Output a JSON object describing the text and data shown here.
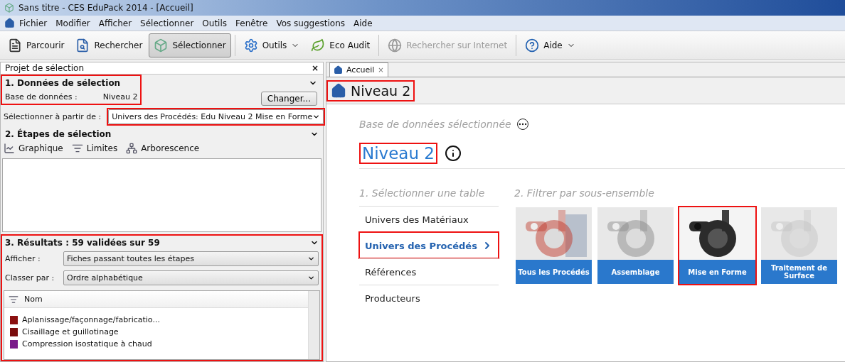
{
  "window": {
    "title": "Sans titre - CES EduPack 2014 - [Accueil]"
  },
  "menu": [
    "Fichier",
    "Modifier",
    "Afficher",
    "Sélectionner",
    "Outils",
    "Fenêtre",
    "Vos suggestions",
    "Aide"
  ],
  "toolbar": [
    {
      "label": "Parcourir",
      "kind": "browse",
      "selected": false,
      "disabled": false,
      "dropdown": false
    },
    {
      "label": "Rechercher",
      "kind": "search",
      "selected": false,
      "disabled": false,
      "dropdown": false
    },
    {
      "label": "Sélectionner",
      "kind": "select",
      "selected": true,
      "disabled": false,
      "dropdown": false
    },
    {
      "label": "Outils",
      "kind": "tools",
      "selected": false,
      "disabled": false,
      "dropdown": true
    },
    {
      "label": "Eco Audit",
      "kind": "eco",
      "selected": false,
      "disabled": false,
      "dropdown": false
    },
    {
      "label": "Rechercher sur Internet",
      "kind": "web",
      "selected": false,
      "disabled": true,
      "dropdown": false
    },
    {
      "label": "Aide",
      "kind": "help",
      "selected": false,
      "disabled": false,
      "dropdown": true
    }
  ],
  "left_panel": {
    "title": "Projet de sélection",
    "close": "×",
    "data_section": {
      "title": "1. Données de sélection",
      "highlighted": true,
      "database_label": "Base de données :",
      "database_value": "Niveau 2",
      "change_button": "Changer..."
    },
    "select_from": {
      "label": "Sélectionner à partir de :",
      "value": "Univers des Procédés: Edu Niveau 2 Mise en Forme",
      "highlighted": true
    },
    "steps_section": {
      "title": "2. Étapes de sélection",
      "tools": [
        {
          "label": "Graphique",
          "kind": "chart"
        },
        {
          "label": "Limites",
          "kind": "limits"
        },
        {
          "label": "Arborescence",
          "kind": "tree"
        }
      ]
    },
    "results_section": {
      "title": "3. Résultats : 59 validées sur 59",
      "highlighted": true,
      "show": {
        "label": "Afficher :",
        "value": "Fiches passant toutes les étapes"
      },
      "sort": {
        "label": "Classer par :",
        "value": "Ordre alphabétique"
      },
      "column": "Nom",
      "rows": [
        {
          "name": "Aplanissage/façonnage/fabricatio...",
          "color": "#8b1010"
        },
        {
          "name": "Cisaillage et guillotinage",
          "color": "#7a0c0c"
        },
        {
          "name": "Compression isostatique à chaud",
          "color": "#7a1a8a"
        }
      ]
    }
  },
  "tabs": [
    {
      "label": "Accueil",
      "selected": true,
      "close": "×"
    }
  ],
  "page": {
    "header": {
      "title": "Niveau 2",
      "highlighted": true
    },
    "database_caption": "Base de données sélectionnée",
    "database_name": {
      "text": "Niveau 2",
      "highlighted": true
    },
    "tables_title": "1. Sélectionner une table",
    "tables": [
      {
        "label": "Univers des Matériaux",
        "selected": false,
        "highlighted": false
      },
      {
        "label": "Univers des Procédés",
        "selected": true,
        "highlighted": true
      },
      {
        "label": "Références",
        "selected": false,
        "highlighted": false
      },
      {
        "label": "Producteurs",
        "selected": false,
        "highlighted": false
      }
    ],
    "subsets_title": "2. Filtrer par sous-ensemble",
    "subsets": [
      {
        "label": "Tous les Procédés",
        "kind": "picture",
        "highlighted": false
      },
      {
        "label": "Assemblage",
        "kind": "picture",
        "highlighted": false
      },
      {
        "label": "Mise en Forme",
        "kind": "picture",
        "highlighted": true
      },
      {
        "label": "Traitement de Surface",
        "kind": "picture",
        "highlighted": false
      }
    ]
  }
}
